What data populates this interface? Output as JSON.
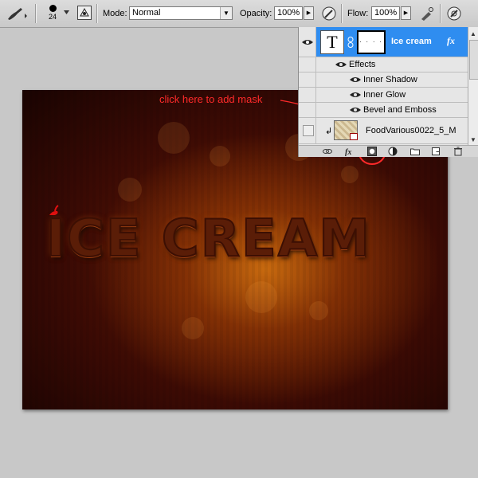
{
  "options_bar": {
    "brush_size": "24",
    "mode_label": "Mode:",
    "mode_value": "Normal",
    "opacity_label": "Opacity:",
    "opacity_value": "100%",
    "flow_label": "Flow:",
    "flow_value": "100%"
  },
  "canvas": {
    "headline": "ICE CREAM",
    "colors": {
      "glow": "#c86a12",
      "dark": "#1c0402",
      "text": "#5a1d07"
    }
  },
  "annotation": {
    "text": "click here to add mask",
    "color": "#ff2a2a"
  },
  "layers": {
    "selected_layer": "Ice cream",
    "fx_badge": "fx",
    "mask_dots": ". . . .",
    "effects_label": "Effects",
    "effects": [
      "Inner Shadow",
      "Inner Glow",
      "Bevel and Emboss"
    ],
    "other_layer": "FoodVarious0022_5_M",
    "selection_color": "#2f8df0",
    "bottom_icons": [
      "link-icon",
      "fx-icon",
      "add-mask-icon",
      "adjustment-icon",
      "group-icon",
      "new-layer-icon",
      "trash-icon"
    ]
  }
}
